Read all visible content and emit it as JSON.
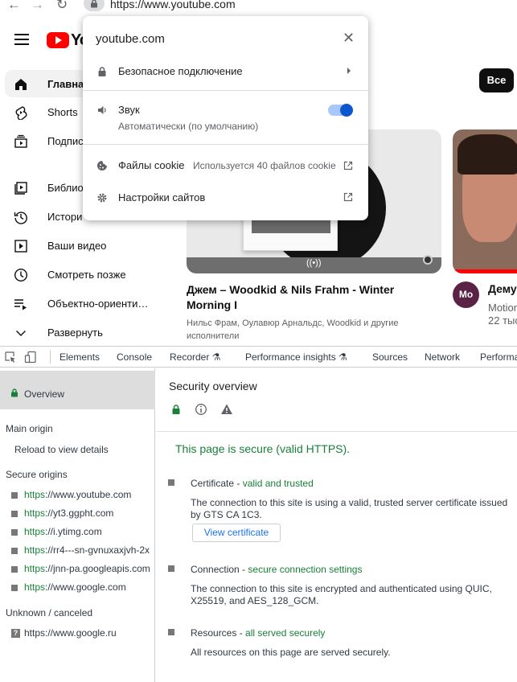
{
  "browser": {
    "url": "https://www.youtube.com"
  },
  "youtube": {
    "logo_text": "Yo",
    "sidebar": [
      {
        "label": "Главная",
        "icon": "home-icon"
      },
      {
        "label": "Shorts",
        "icon": "shorts-icon"
      },
      {
        "label": "Подпис",
        "icon": "subscriptions-icon"
      },
      {
        "label": "Библио",
        "icon": "library-icon"
      },
      {
        "label": "Истори",
        "icon": "history-icon"
      },
      {
        "label": "Ваши видео",
        "icon": "your-videos-icon"
      },
      {
        "label": "Смотреть позже",
        "icon": "watch-later-icon"
      },
      {
        "label": "Объектно-ориенти…",
        "icon": "playlist-icon"
      },
      {
        "label": "Развернуть",
        "icon": "chevron-down-icon"
      }
    ],
    "chip_all": "Все",
    "video1": {
      "title": "Джем – Woodkid & Nils Frahm - Winter Morning I",
      "meta": "Нильс Фрам, Оулавюр Арнальдс, Woodkid и другие исполнители"
    },
    "video2": {
      "title": "Дему",
      "channel": "Motion",
      "views": "22 тыс"
    }
  },
  "popup": {
    "domain": "youtube.com",
    "connection": "Безопасное подключение",
    "sound_label": "Звук",
    "sound_sub": "Автоматически (по умолчанию)",
    "sound_on": true,
    "cookies_label": "Файлы cookie",
    "cookies_value": "Используется 40 файлов cookie",
    "site_settings": "Настройки сайтов"
  },
  "devtools": {
    "tabs": [
      "Elements",
      "Console",
      "Recorder",
      "Performance insights",
      "Sources",
      "Network",
      "Performa"
    ],
    "sidebar": {
      "overview": "Overview",
      "main_origin_head": "Main origin",
      "main_origin_item": "Reload to view details",
      "secure_head": "Secure origins",
      "secure_origins": [
        {
          "scheme": "https",
          "rest": "://www.youtube.com"
        },
        {
          "scheme": "https",
          "rest": "://yt3.ggpht.com"
        },
        {
          "scheme": "https",
          "rest": "://i.ytimg.com"
        },
        {
          "scheme": "https",
          "rest": "://rr4---sn-gvnuxaxjvh-2x"
        },
        {
          "scheme": "https",
          "rest": "://jnn-pa.googleapis.com"
        },
        {
          "scheme": "https",
          "rest": "://www.google.com"
        }
      ],
      "unknown_head": "Unknown / canceled",
      "unknown_origins": [
        "https://www.google.ru"
      ]
    },
    "main": {
      "title": "Security overview",
      "secure_message": "This page is secure (valid HTTPS).",
      "certificate_head": "Certificate",
      "certificate_status": "valid and trusted",
      "certificate_body": "The connection to this site is using a valid, trusted server certificate issued by GTS CA 1C3.",
      "view_certificate": "View certificate",
      "connection_head": "Connection",
      "connection_status": "secure connection settings",
      "connection_body": "The connection to this site is encrypted and authenticated using QUIC, X25519, and AES_128_GCM.",
      "resources_head": "Resources",
      "resources_status": "all served securely",
      "resources_body": "All resources on this page are served securely."
    }
  },
  "colors": {
    "secure_green": "#188038",
    "yt_red": "#ff0000",
    "toggle_blue": "#0b57d0",
    "link_blue": "#1a73e8"
  }
}
